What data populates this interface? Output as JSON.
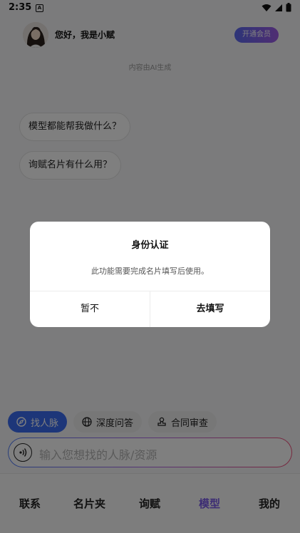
{
  "status_bar": {
    "time": "2:35",
    "notification_badge": "A"
  },
  "header": {
    "greeting": "您好，我是小赋",
    "vip_button": "开通会员"
  },
  "ai_note": "内容由AI生成",
  "suggestions": [
    "模型都能帮我做什么？",
    "询赋名片有什么用？"
  ],
  "chips": [
    {
      "label": "找人脉",
      "icon": "compass-icon",
      "active": true
    },
    {
      "label": "深度问答",
      "icon": "globe-icon",
      "active": false
    },
    {
      "label": "合同审查",
      "icon": "stamp-icon",
      "active": false
    }
  ],
  "input": {
    "placeholder": "输入您想找的人脉/资源"
  },
  "tabs": [
    {
      "label": "联系",
      "active": false
    },
    {
      "label": "名片夹",
      "active": false
    },
    {
      "label": "询赋",
      "active": false
    },
    {
      "label": "模型",
      "active": true
    },
    {
      "label": "我的",
      "active": false
    }
  ],
  "dialog": {
    "title": "身份认证",
    "message": "此功能需要完成名片填写后使用。",
    "cancel": "暂不",
    "confirm": "去填写"
  },
  "colors": {
    "accent": "#3b6df2",
    "active_tab": "#7a5be8",
    "overlay": "rgba(0,0,0,0.5)"
  }
}
